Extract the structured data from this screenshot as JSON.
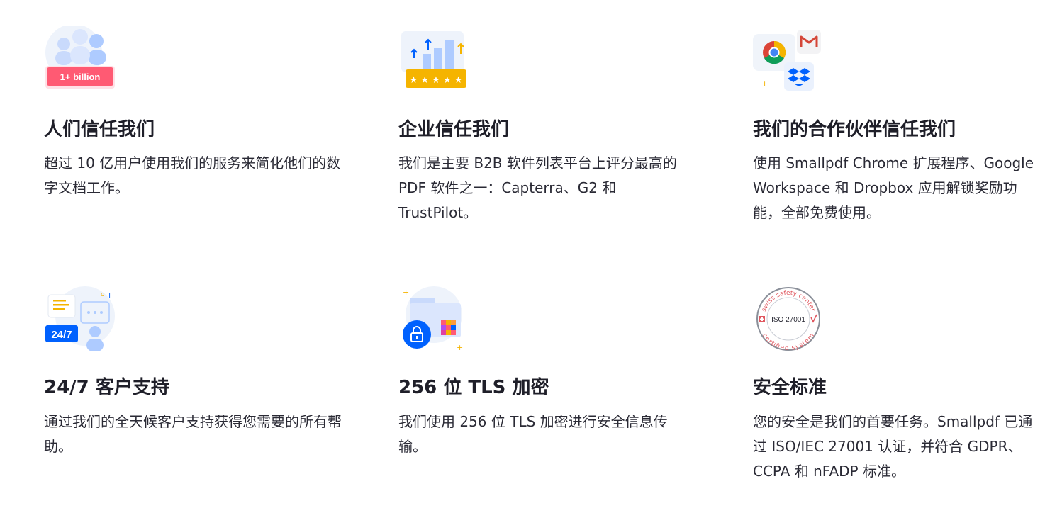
{
  "features": [
    {
      "title": "人们信任我们",
      "description": "超过 10 亿用户使用我们的服务来简化他们的数字文档工作。",
      "badge": "1+ billion",
      "icon": "users-group-icon"
    },
    {
      "title": "企业信任我们",
      "description": "我们是主要 B2B 软件列表平台上评分最高的 PDF 软件之一：Capterra、G2 和 TrustPilot。",
      "icon": "rating-chart-icon"
    },
    {
      "title": "我们的合作伙伴信任我们",
      "description": "使用 Smallpdf Chrome 扩展程序、Google Workspace 和 Dropbox 应用解锁奖励功能，全部免费使用。",
      "icon": "partner-apps-icon"
    },
    {
      "title": "24/7 客户支持",
      "description": "通过我们的全天候客户支持获得您需要的所有帮助。",
      "badge": "24/7",
      "icon": "chat-support-icon"
    },
    {
      "title": "256 位 TLS 加密",
      "description": "我们使用 256 位 TLS 加密进行安全信息传输。",
      "icon": "encrypted-folder-icon"
    },
    {
      "title": "安全标准",
      "description": "您的安全是我们的首要任务。Smallpdf 已通过 ISO/IEC 27001 认证，并符合 GDPR、CCPA 和 nFADP 标准。",
      "seal": {
        "top_text": "swiss safety center",
        "center_text": "ISO 27001",
        "bottom_text": "certified system"
      },
      "icon": "iso-certificate-seal-icon"
    }
  ],
  "colors": {
    "accent_blue": "#0061fe",
    "brand_red": "#ff5a73",
    "star_yellow": "#f5b400",
    "soft_blue": "#aecbff"
  }
}
